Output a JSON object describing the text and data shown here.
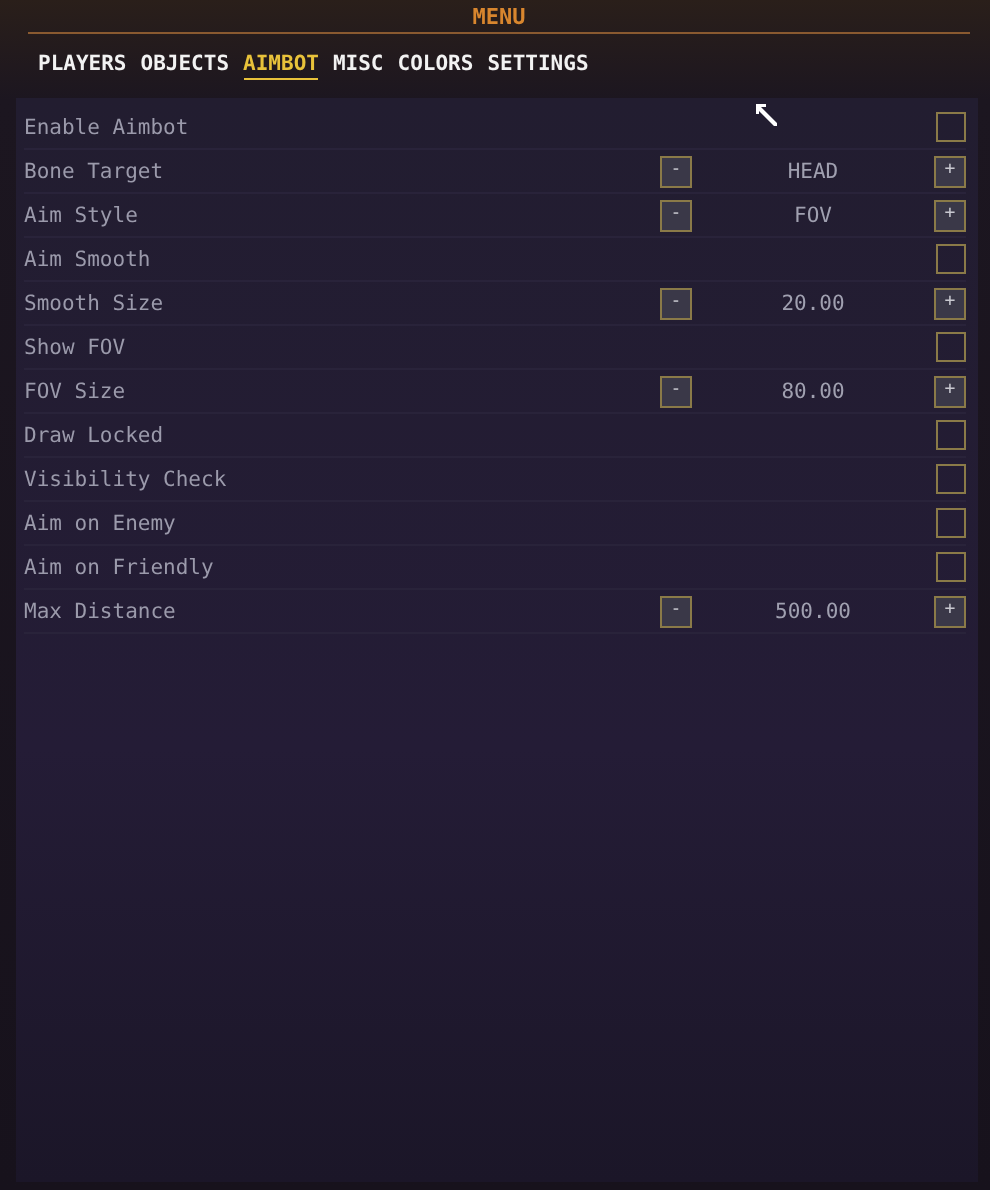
{
  "window": {
    "title": "MENU"
  },
  "tabs": [
    {
      "label": "PLAYERS",
      "selected": false
    },
    {
      "label": "OBJECTS",
      "selected": false
    },
    {
      "label": "AIMBOT",
      "selected": true
    },
    {
      "label": "MISC",
      "selected": false
    },
    {
      "label": "COLORS",
      "selected": false
    },
    {
      "label": "SETTINGS",
      "selected": false
    }
  ],
  "options": [
    {
      "kind": "toggle",
      "label": "Enable Aimbot",
      "checked": false
    },
    {
      "kind": "stepper",
      "label": "Bone Target",
      "decrement": "-",
      "value": "HEAD",
      "increment": "+"
    },
    {
      "kind": "stepper",
      "label": "Aim Style",
      "decrement": "-",
      "value": "FOV",
      "increment": "+"
    },
    {
      "kind": "toggle",
      "label": "Aim Smooth",
      "checked": false
    },
    {
      "kind": "stepper",
      "label": "Smooth Size",
      "decrement": "-",
      "value": "20.00",
      "increment": "+"
    },
    {
      "kind": "toggle",
      "label": "Show FOV",
      "checked": false
    },
    {
      "kind": "stepper",
      "label": "FOV Size",
      "decrement": "-",
      "value": "80.00",
      "increment": "+"
    },
    {
      "kind": "toggle",
      "label": "Draw Locked",
      "checked": false
    },
    {
      "kind": "toggle",
      "label": "Visibility Check",
      "checked": false
    },
    {
      "kind": "toggle",
      "label": "Aim on Enemy",
      "checked": false
    },
    {
      "kind": "toggle",
      "label": "Aim on Friendly",
      "checked": false
    },
    {
      "kind": "stepper",
      "label": "Max Distance",
      "decrement": "-",
      "value": "500.00",
      "increment": "+"
    }
  ]
}
